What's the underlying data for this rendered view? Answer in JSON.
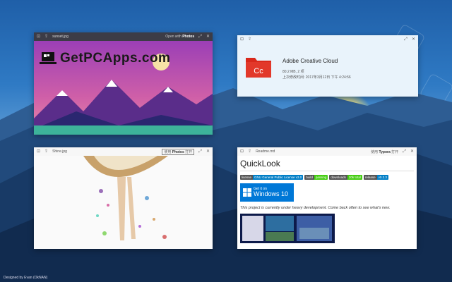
{
  "desktop": {
    "credit": "Designed by Evan (OkNAN)"
  },
  "win1": {
    "filename": "sunset.jpg",
    "open_with_prefix": "Open with",
    "open_with_app": "Photos",
    "watermark": "GetPCApps.com"
  },
  "win2": {
    "title": "Adobe Creative Cloud",
    "size": "80.2 MB, 2 项",
    "modified": "上次修改时间: 2017年3月12日 下午 4:24:56"
  },
  "win3": {
    "filename": "Shine.jpg",
    "open_with_prefix": "使用",
    "open_with_app": "Photos",
    "open_with_suffix": "打开"
  },
  "win4": {
    "filename": "Readme.md",
    "open_with_prefix": "使用",
    "open_with_app": "Typora",
    "open_with_suffix": "打开",
    "heading": "QuickLook",
    "badges": [
      {
        "left": "license",
        "right": "GNU General Public License v3.0",
        "color": "#007ec6"
      },
      {
        "left": "build",
        "right": "passing",
        "color": "#4c1"
      },
      {
        "left": "downloads",
        "right": "20k total",
        "color": "#4c1"
      },
      {
        "left": "release",
        "right": "v0.2.3",
        "color": "#007ec6"
      }
    ],
    "store_small": "Get it on",
    "store_big": "Windows 10",
    "dev_note": "This project is currently under heavy development. Come back often to see what's new."
  },
  "colors": {
    "accent": "#0078d7",
    "folder": "#d9281b"
  }
}
